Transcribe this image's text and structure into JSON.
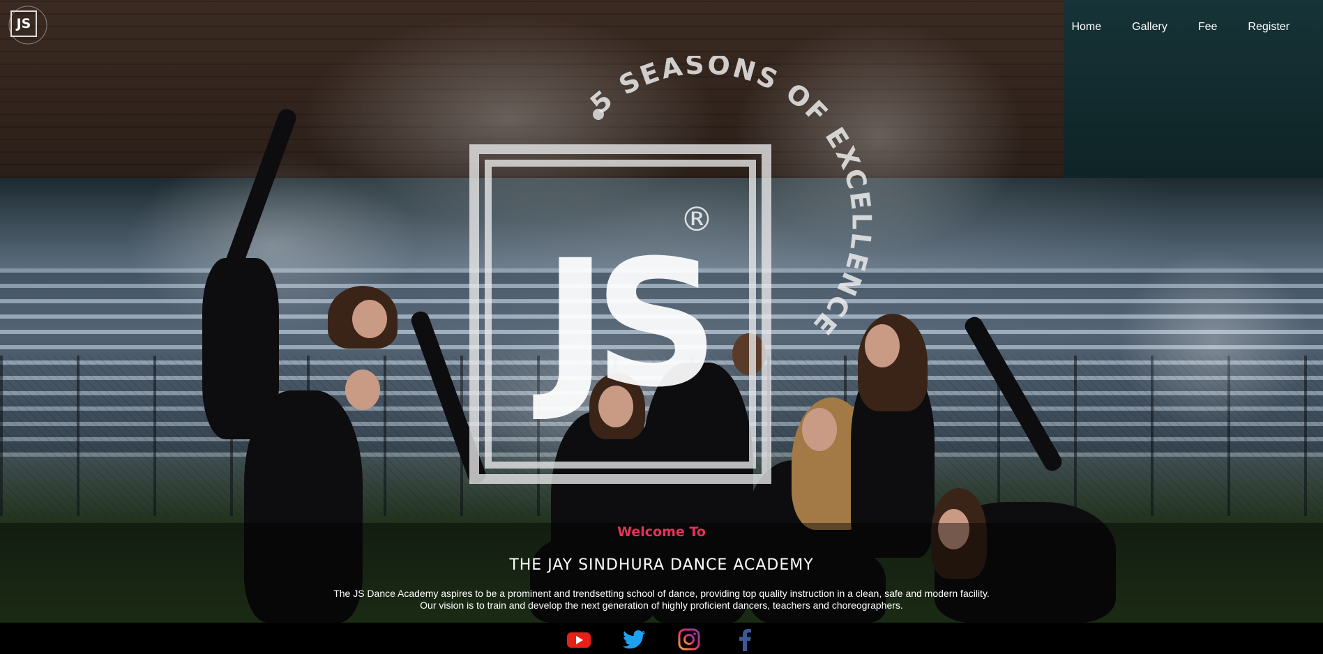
{
  "site": {
    "logo_text": "JS",
    "logo_ring_text": "5 SEASONS OF EXCELLENCE"
  },
  "nav": {
    "items": [
      {
        "label": "Home"
      },
      {
        "label": "Gallery"
      },
      {
        "label": "Fee"
      },
      {
        "label": "Register"
      }
    ]
  },
  "hero": {
    "emblem_letters": "JS",
    "emblem_arc_text": "5 SEASONS OF EXCELLENCE",
    "registered_mark": "®"
  },
  "welcome": {
    "label": "Welcome To",
    "title": "THE JAY SINDHURA DANCE ACADEMY",
    "mission_line1": "The JS Dance Academy aspires to be a prominent and trendsetting school of dance, providing top quality instruction in a clean, safe and modern facility.",
    "mission_line2": "Our vision is to train and develop the next generation of highly proficient dancers, teachers and choreographers."
  },
  "footer": {
    "social": [
      {
        "name": "youtube-icon",
        "color": "#e62117"
      },
      {
        "name": "twitter-icon",
        "color": "#1da1f2"
      },
      {
        "name": "instagram-icon",
        "color": "#c13584"
      },
      {
        "name": "facebook-icon",
        "color": "#3b5998"
      }
    ]
  },
  "colors": {
    "accent": "#e8315a",
    "background": "#000000"
  }
}
